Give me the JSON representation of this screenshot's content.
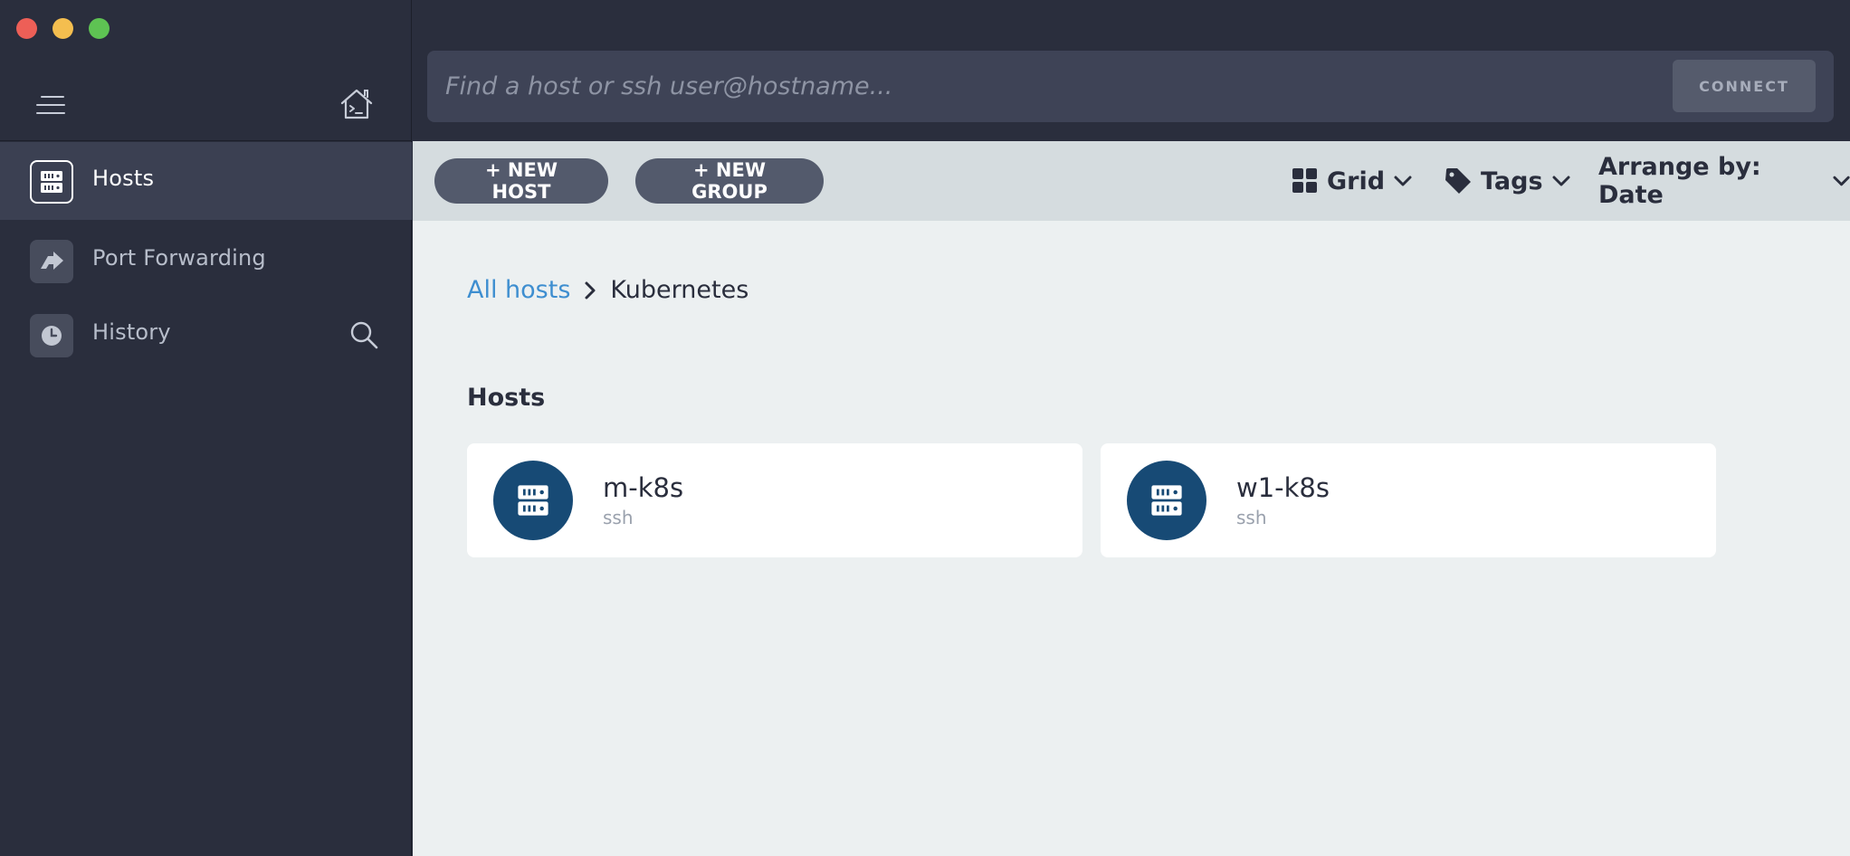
{
  "window": {
    "controls": [
      "close",
      "minimize",
      "zoom"
    ]
  },
  "sidebar": {
    "items": [
      {
        "label": "Hosts",
        "icon": "server-icon",
        "active": true
      },
      {
        "label": "Port Forwarding",
        "icon": "forward-arrow-icon",
        "active": false
      },
      {
        "label": "History",
        "icon": "clock-icon",
        "active": false
      }
    ]
  },
  "search": {
    "placeholder": "Find a host or ssh user@hostname...",
    "value": "",
    "connect_label": "CONNECT"
  },
  "toolbar": {
    "new_host_label": "+ NEW HOST",
    "new_group_label": "+ NEW GROUP",
    "view_label": "Grid",
    "tags_label": "Tags",
    "arrange_label": "Arrange by: Date"
  },
  "breadcrumb": {
    "root": "All hosts",
    "current": "Kubernetes"
  },
  "section": {
    "title": "Hosts"
  },
  "hosts": [
    {
      "name": "m-k8s",
      "protocol": "ssh"
    },
    {
      "name": "w1-k8s",
      "protocol": "ssh"
    }
  ],
  "colors": {
    "sidebar_bg": "#2a2e3d",
    "accent_link": "#3e8ed0",
    "host_avatar": "#174a75",
    "content_bg": "#ecf0f1"
  }
}
